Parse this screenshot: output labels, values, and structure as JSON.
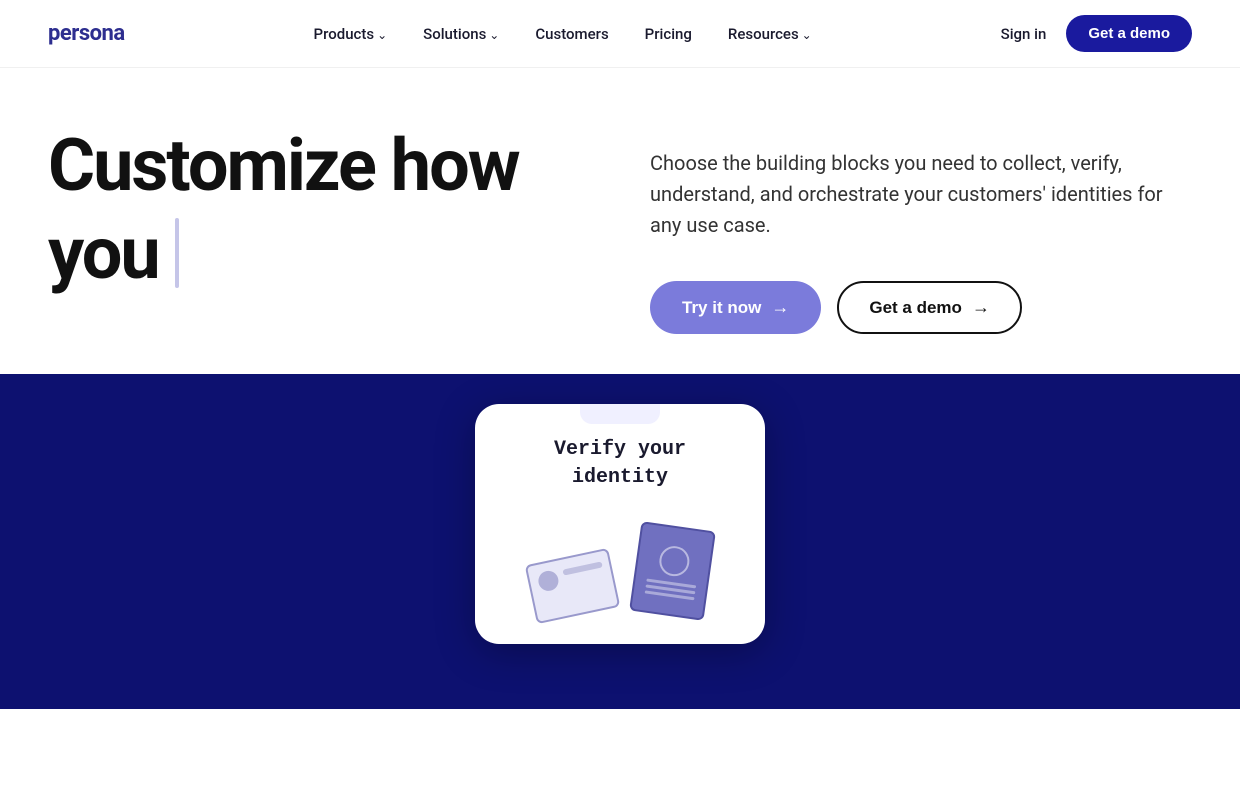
{
  "logo": {
    "text": "persona"
  },
  "nav": {
    "links": [
      {
        "label": "Products",
        "hasArrow": true
      },
      {
        "label": "Solutions",
        "hasArrow": true
      },
      {
        "label": "Customers",
        "hasArrow": false
      },
      {
        "label": "Pricing",
        "hasArrow": false
      },
      {
        "label": "Resources",
        "hasArrow": true
      }
    ],
    "sign_in": "Sign in",
    "get_demo": "Get a demo"
  },
  "hero": {
    "heading_line1": "Customize how",
    "heading_line2": "you",
    "description": "Choose the building blocks you need to collect, verify, understand, and orchestrate your customers' identities for any use case.",
    "btn_try": "Try it now",
    "btn_demo": "Get a demo"
  },
  "dark_section": {
    "card_title_line1": "Verify your",
    "card_title_line2": "identity"
  }
}
